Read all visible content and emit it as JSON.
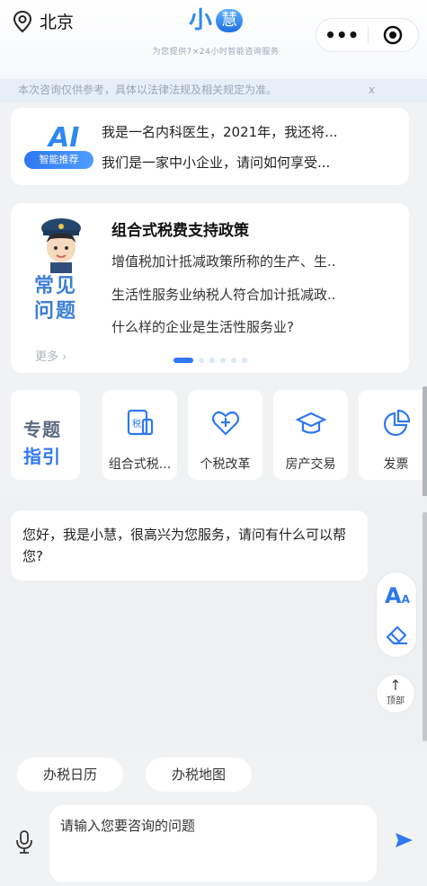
{
  "header": {
    "location": "北京",
    "logo_text": "小",
    "logo_badge": "慧",
    "logo_subtitle": "为您提供7×24小时智能咨询服务"
  },
  "notice": {
    "text": "本次咨询仅供参考，具体以法律法规及相关规定为准。",
    "close": "x"
  },
  "recommend": {
    "badge": "智能推荐",
    "ai": "AI",
    "items": [
      "我是一名内科医生，2021年，我还将...",
      "我们是一家中小企业，请问如何享受..."
    ]
  },
  "faq": {
    "side_words": [
      "常见",
      "问题"
    ],
    "more": "更多",
    "title": "组合式税费支持政策",
    "items": [
      "增值税加计抵减政策所称的生产、生..",
      "生活性服务业纳税人符合加计抵减政..",
      "什么样的企业是生活性服务业?"
    ]
  },
  "topics": {
    "guide_words": [
      "专题",
      "指引"
    ],
    "items": [
      {
        "label": "组合式税...",
        "icon": "tax-doc-icon"
      },
      {
        "label": "个税改革",
        "icon": "heart-plus-icon"
      },
      {
        "label": "房产交易",
        "icon": "cap-icon"
      },
      {
        "label": "发票",
        "icon": "pie-icon"
      }
    ]
  },
  "chat": {
    "greeting": "您好，我是小慧，很高兴为您服务，请问有什么可以帮您?"
  },
  "tools": {
    "font_label": "A",
    "font_small": "A",
    "top_label": "顶部"
  },
  "quick": {
    "items": [
      "办税日历",
      "办税地图"
    ]
  },
  "input": {
    "placeholder": "请输入您要咨询的问题"
  },
  "colors": {
    "accent": "#2f78f0",
    "faq_word": "#3d7fd6"
  }
}
